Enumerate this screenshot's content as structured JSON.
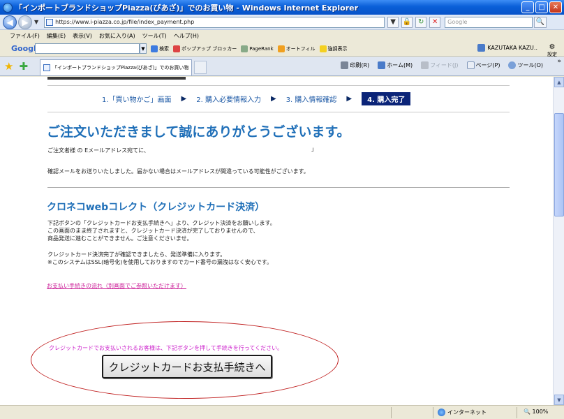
{
  "window": {
    "title": "「インポートブランドショップPiazza(ぴあざ)」でのお買い物 - Windows Internet Explorer",
    "minimize": "_",
    "maximize": "□",
    "close": "✕"
  },
  "address": {
    "back": "◀",
    "forward": "▶",
    "dropdown": "▼",
    "url": "https://www.i-piazza.co.jp/file/index_payment.php",
    "lock": "🔒",
    "refresh": "↻",
    "stop": "✕",
    "search_placeholder": "Google",
    "search_go": "🔍"
  },
  "menu": {
    "items": [
      "ファイル(F)",
      "編集(E)",
      "表示(V)",
      "お気に入り(A)",
      "ツール(T)",
      "ヘルプ(H)"
    ]
  },
  "google_toolbar": {
    "logo": "Google",
    "search_button": "検索",
    "buttons": [
      "ポップアップ ブロッカー",
      "PageRank",
      "オートフィル",
      "強調表示"
    ],
    "user": "KAZUTAKA KAZU..",
    "settings": "設定"
  },
  "tabs": {
    "favorites_icon": "★",
    "add_favorites_icon": "✚",
    "active_tab": "「インポートブランドショップPiazza(ぴあざ)」でのお買い物",
    "commands": {
      "print": "印刷(R)",
      "home": "ホーム(M)",
      "feeds": "フィード(J)",
      "page": "ページ(P)",
      "tools": "ツール(O)"
    },
    "chevron": "»"
  },
  "content": {
    "steps": [
      {
        "label": "1.「買い物かご」画面"
      },
      {
        "label": "2. 購入必要情報入力"
      },
      {
        "label": "3. 購入情報確認"
      },
      {
        "label": "4. 購入完了"
      }
    ],
    "step_arrow": "▶",
    "thanks_heading": "ご注文いただきまして誠にありがとうございます。",
    "email_line": "ご注文者様 の Eメールアドレス宛てに、",
    "email_suffix": "」",
    "confirm_line": "確認メールをお送りいたしました。届かない場合はメールアドレスが間違っている可能性がございます。",
    "section_heading": "クロネコwebコレクト（クレジットカード決済）",
    "para1": [
      "下記ボタンの「クレジットカードお支払手続きへ」より、クレジット決済をお願いします。",
      "この画面のまま終了されますと、クレジットカード決済が完了しておりませんので、",
      "商品発送に進むことができません。ご注意くださいませ。"
    ],
    "para2": [
      "クレジットカード決済完了が確認できましたら、発送準備に入ります。",
      "※このシステムはSSL(暗号化)を使用しておりますのでカード番号の漏洩はなく安心です。"
    ],
    "flow_link": "お支払い手続きの流れ（別画面でご参照いただけます）",
    "notice": "クレジットカードでお支払いされるお客様は、下記ボタンを押して手続きを行ってください。",
    "pay_button": "クレジットカードお支払手続きへ"
  },
  "scrollbar": {
    "up": "▲",
    "down": "▼"
  },
  "status": {
    "zone": "インターネット",
    "zoom": "100%"
  },
  "colors": {
    "title_blue": "#0a5fd8",
    "heading_blue": "#1f6fb8",
    "active_step_bg": "#0b2478",
    "notice_magenta": "#cc22cc",
    "ellipse_red": "#c02020"
  }
}
